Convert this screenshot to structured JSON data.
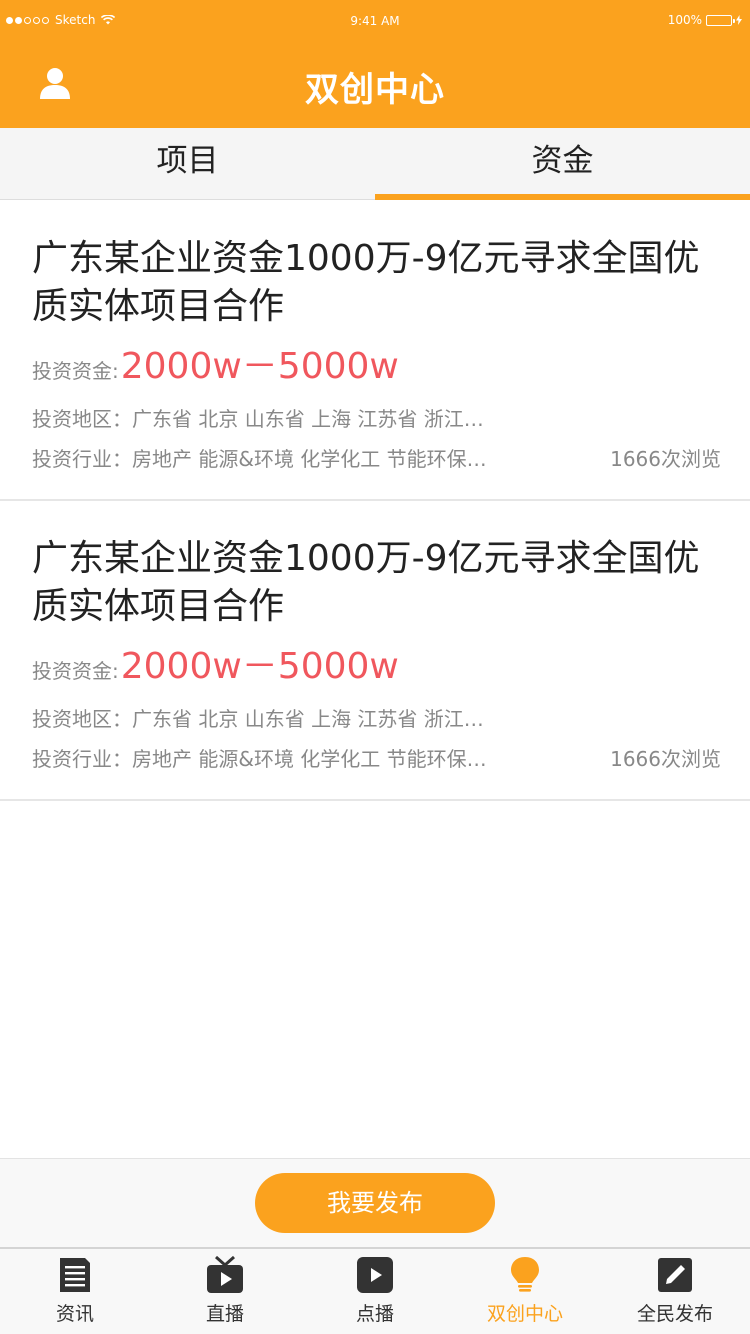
{
  "status_bar": {
    "carrier": "Sketch",
    "time": "9:41 AM",
    "battery": "100%"
  },
  "nav": {
    "title": "双创中心",
    "profile_icon": "user-icon"
  },
  "tabs": [
    {
      "label": "项目",
      "active": false
    },
    {
      "label": "资金",
      "active": true
    }
  ],
  "cards": [
    {
      "title": "广东某企业资金1000万-9亿元寻求全国优质实体项目合作",
      "price_label": "投资资金:",
      "price": "2000w－5000w",
      "region": "投资地区：广东省 北京 山东省 上海 江苏省 浙江…",
      "industry": "投资行业：房地产 能源&环境 化学化工 节能环保…",
      "views": "1666次浏览"
    },
    {
      "title": "广东某企业资金1000万-9亿元寻求全国优质实体项目合作",
      "price_label": "投资资金:",
      "price": "2000w－5000w",
      "region": "投资地区：广东省 北京 山东省 上海 江苏省 浙江…",
      "industry": "投资行业：房地产 能源&环境 化学化工 节能环保…",
      "views": "1666次浏览"
    }
  ],
  "publish_button": "我要发布",
  "tabbar": [
    {
      "label": "资讯",
      "icon": "news-icon",
      "active": false
    },
    {
      "label": "直播",
      "icon": "tv-icon",
      "active": false
    },
    {
      "label": "点播",
      "icon": "play-icon",
      "active": false
    },
    {
      "label": "双创中心",
      "icon": "lightbulb-icon",
      "active": true
    },
    {
      "label": "全民发布",
      "icon": "edit-icon",
      "active": false
    }
  ],
  "colors": {
    "brand": "#FBA21E",
    "price": "#F0575D",
    "muted_text": "#888888"
  }
}
